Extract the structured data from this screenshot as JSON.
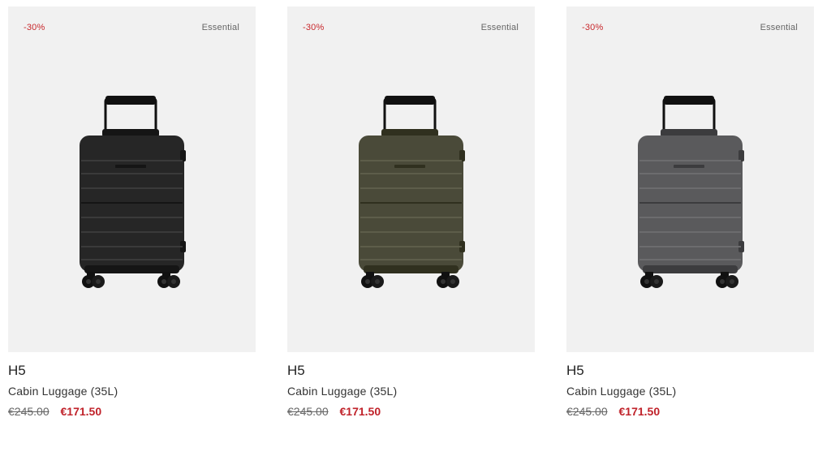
{
  "products": [
    {
      "discount": "-30%",
      "line": "Essential",
      "name": "H5",
      "subtitle": "Cabin Luggage (35L)",
      "old_price": "€245.00",
      "new_price": "€171.50",
      "color": "#262626",
      "color_dark": "#151515",
      "color_light": "#3a3a3a"
    },
    {
      "discount": "-30%",
      "line": "Essential",
      "name": "H5",
      "subtitle": "Cabin Luggage (35L)",
      "old_price": "€245.00",
      "new_price": "€171.50",
      "color": "#4a4a39",
      "color_dark": "#30301f",
      "color_light": "#5d5d4a"
    },
    {
      "discount": "-30%",
      "line": "Essential",
      "name": "H5",
      "subtitle": "Cabin Luggage (35L)",
      "old_price": "€245.00",
      "new_price": "€171.50",
      "color": "#5a5a5c",
      "color_dark": "#3c3c3e",
      "color_light": "#6c6c6e"
    }
  ]
}
